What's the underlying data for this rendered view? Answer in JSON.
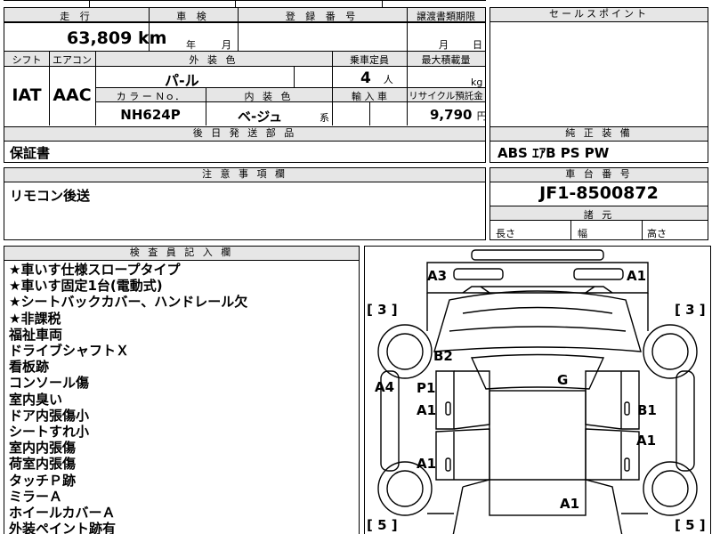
{
  "header": {
    "mileage_label": "走 行",
    "mileage_value": "63,809",
    "mileage_unit": "km",
    "inspection_label": "車 検",
    "inspection_year": "年",
    "inspection_month": "月",
    "registration_label": "登 録 番 号",
    "transfer_label": "譲渡書類期限",
    "transfer_month": "月",
    "transfer_day": "日",
    "sales_point_label": "セールスポイント"
  },
  "specs": {
    "shift_label": "シフト",
    "shift_value": "IAT",
    "ac_label": "エアコン",
    "ac_value": "AAC",
    "exterior_label": "外 装 色",
    "exterior_value": "パ-ル",
    "capacity_label": "乗車定員",
    "capacity_value": "4",
    "capacity_unit": "人",
    "max_load_label": "最大積載量",
    "max_load_unit": "kg",
    "color_no_label": "カ ラ ー Ｎｏ．",
    "color_no_value": "NH624P",
    "interior_label": "内 装 色",
    "interior_value": "ベ-ジュ",
    "interior_suffix": "系",
    "import_label": "輸 入 車",
    "recycle_label": "リサイクル預託金",
    "recycle_value": "9,790",
    "recycle_unit": "円"
  },
  "later_parts": {
    "label": "後 日 発 送 部 品",
    "value": "保証書"
  },
  "standard_equipment": {
    "label": "純 正 装 備",
    "value": "ABS ｴｱB PS PW"
  },
  "notes": {
    "label": "注 意 事 項 欄",
    "value": "リモコン後送"
  },
  "chassis": {
    "label": "車 台 番 号",
    "value": "JF1-8500872",
    "dimensions_label": "諸 元",
    "length_label": "長さ",
    "width_label": "幅",
    "height_label": "高さ"
  },
  "inspector": {
    "label": "検 査 員 記 入 欄",
    "lines": [
      "★車いす仕様スロープタイプ",
      "★車いす固定1台(電動式)",
      "★シートバックカバー、ハンドレール欠",
      "★非課税",
      "福祉車両",
      "ドライブシャフトＸ",
      "看板跡",
      "コンソール傷",
      "室内臭い",
      "ドア内張傷小",
      "シートすれ小",
      "室内内張傷",
      "荷室内張傷",
      "タッチＰ跡",
      "ミラーＡ",
      "ホイールカバーＡ",
      "外装ペイント跡有"
    ]
  },
  "diagram": {
    "bracket_tl": "[ 3 ]",
    "bracket_tr": "[ 3 ]",
    "bracket_bl": "[ 5 ]",
    "bracket_br": "[ 5 ]",
    "marks": {
      "front_left": "A3",
      "front_right": "A1",
      "hood_left": "B2",
      "left_fender": "A4",
      "left_front_door_p": "P1",
      "left_front_door": "A1",
      "left_rear_door": "A1",
      "roof": "G",
      "right_front_door": "B1",
      "right_rear_door": "A1",
      "rear": "A1"
    }
  }
}
